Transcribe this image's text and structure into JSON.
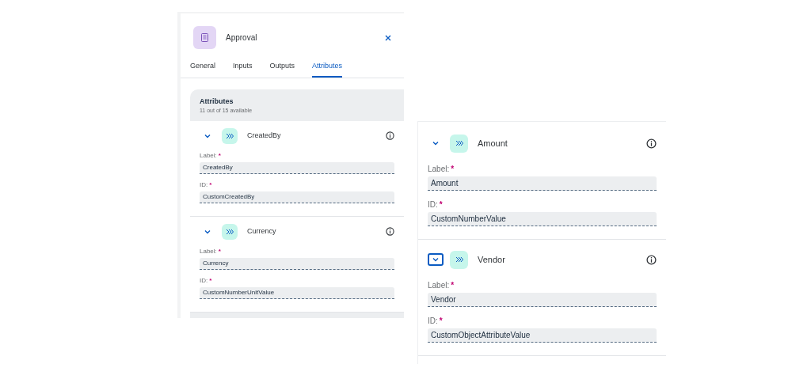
{
  "panel": {
    "title": "Approval",
    "tabs": [
      {
        "label": "General",
        "selected": false
      },
      {
        "label": "Inputs",
        "selected": false
      },
      {
        "label": "Outputs",
        "selected": false
      },
      {
        "label": "Attributes",
        "selected": true
      }
    ],
    "section": {
      "title": "Attributes",
      "subtitle": "11 out of 15 available"
    },
    "attributes": [
      {
        "name": "CreatedBy",
        "expanded": true,
        "focused": false,
        "fields": [
          {
            "label": "Label:",
            "mark": "*",
            "value": "CreatedBy"
          },
          {
            "label": "ID:",
            "mark": "*",
            "value": "CustomCreatedBy"
          }
        ]
      },
      {
        "name": "Currency",
        "expanded": true,
        "focused": false,
        "fields": [
          {
            "label": "Label:",
            "mark": "*",
            "value": "Currency"
          },
          {
            "label": "ID:",
            "mark": "*",
            "value": "CustomNumberUnitValue"
          }
        ]
      }
    ]
  },
  "detail": {
    "attributes": [
      {
        "name": "Amount",
        "expanded": true,
        "focused": false,
        "fields": [
          {
            "label": "Label:",
            "mark": "*",
            "value": "Amount"
          },
          {
            "label": "ID:",
            "mark": "*",
            "value": "CustomNumberValue"
          }
        ]
      },
      {
        "name": "Vendor",
        "expanded": true,
        "focused": true,
        "fields": [
          {
            "label": "Label:",
            "mark": "*",
            "value": "Vendor"
          },
          {
            "label": "ID:",
            "mark": "*",
            "value": "CustomObjectAttributeValue"
          }
        ]
      }
    ]
  }
}
